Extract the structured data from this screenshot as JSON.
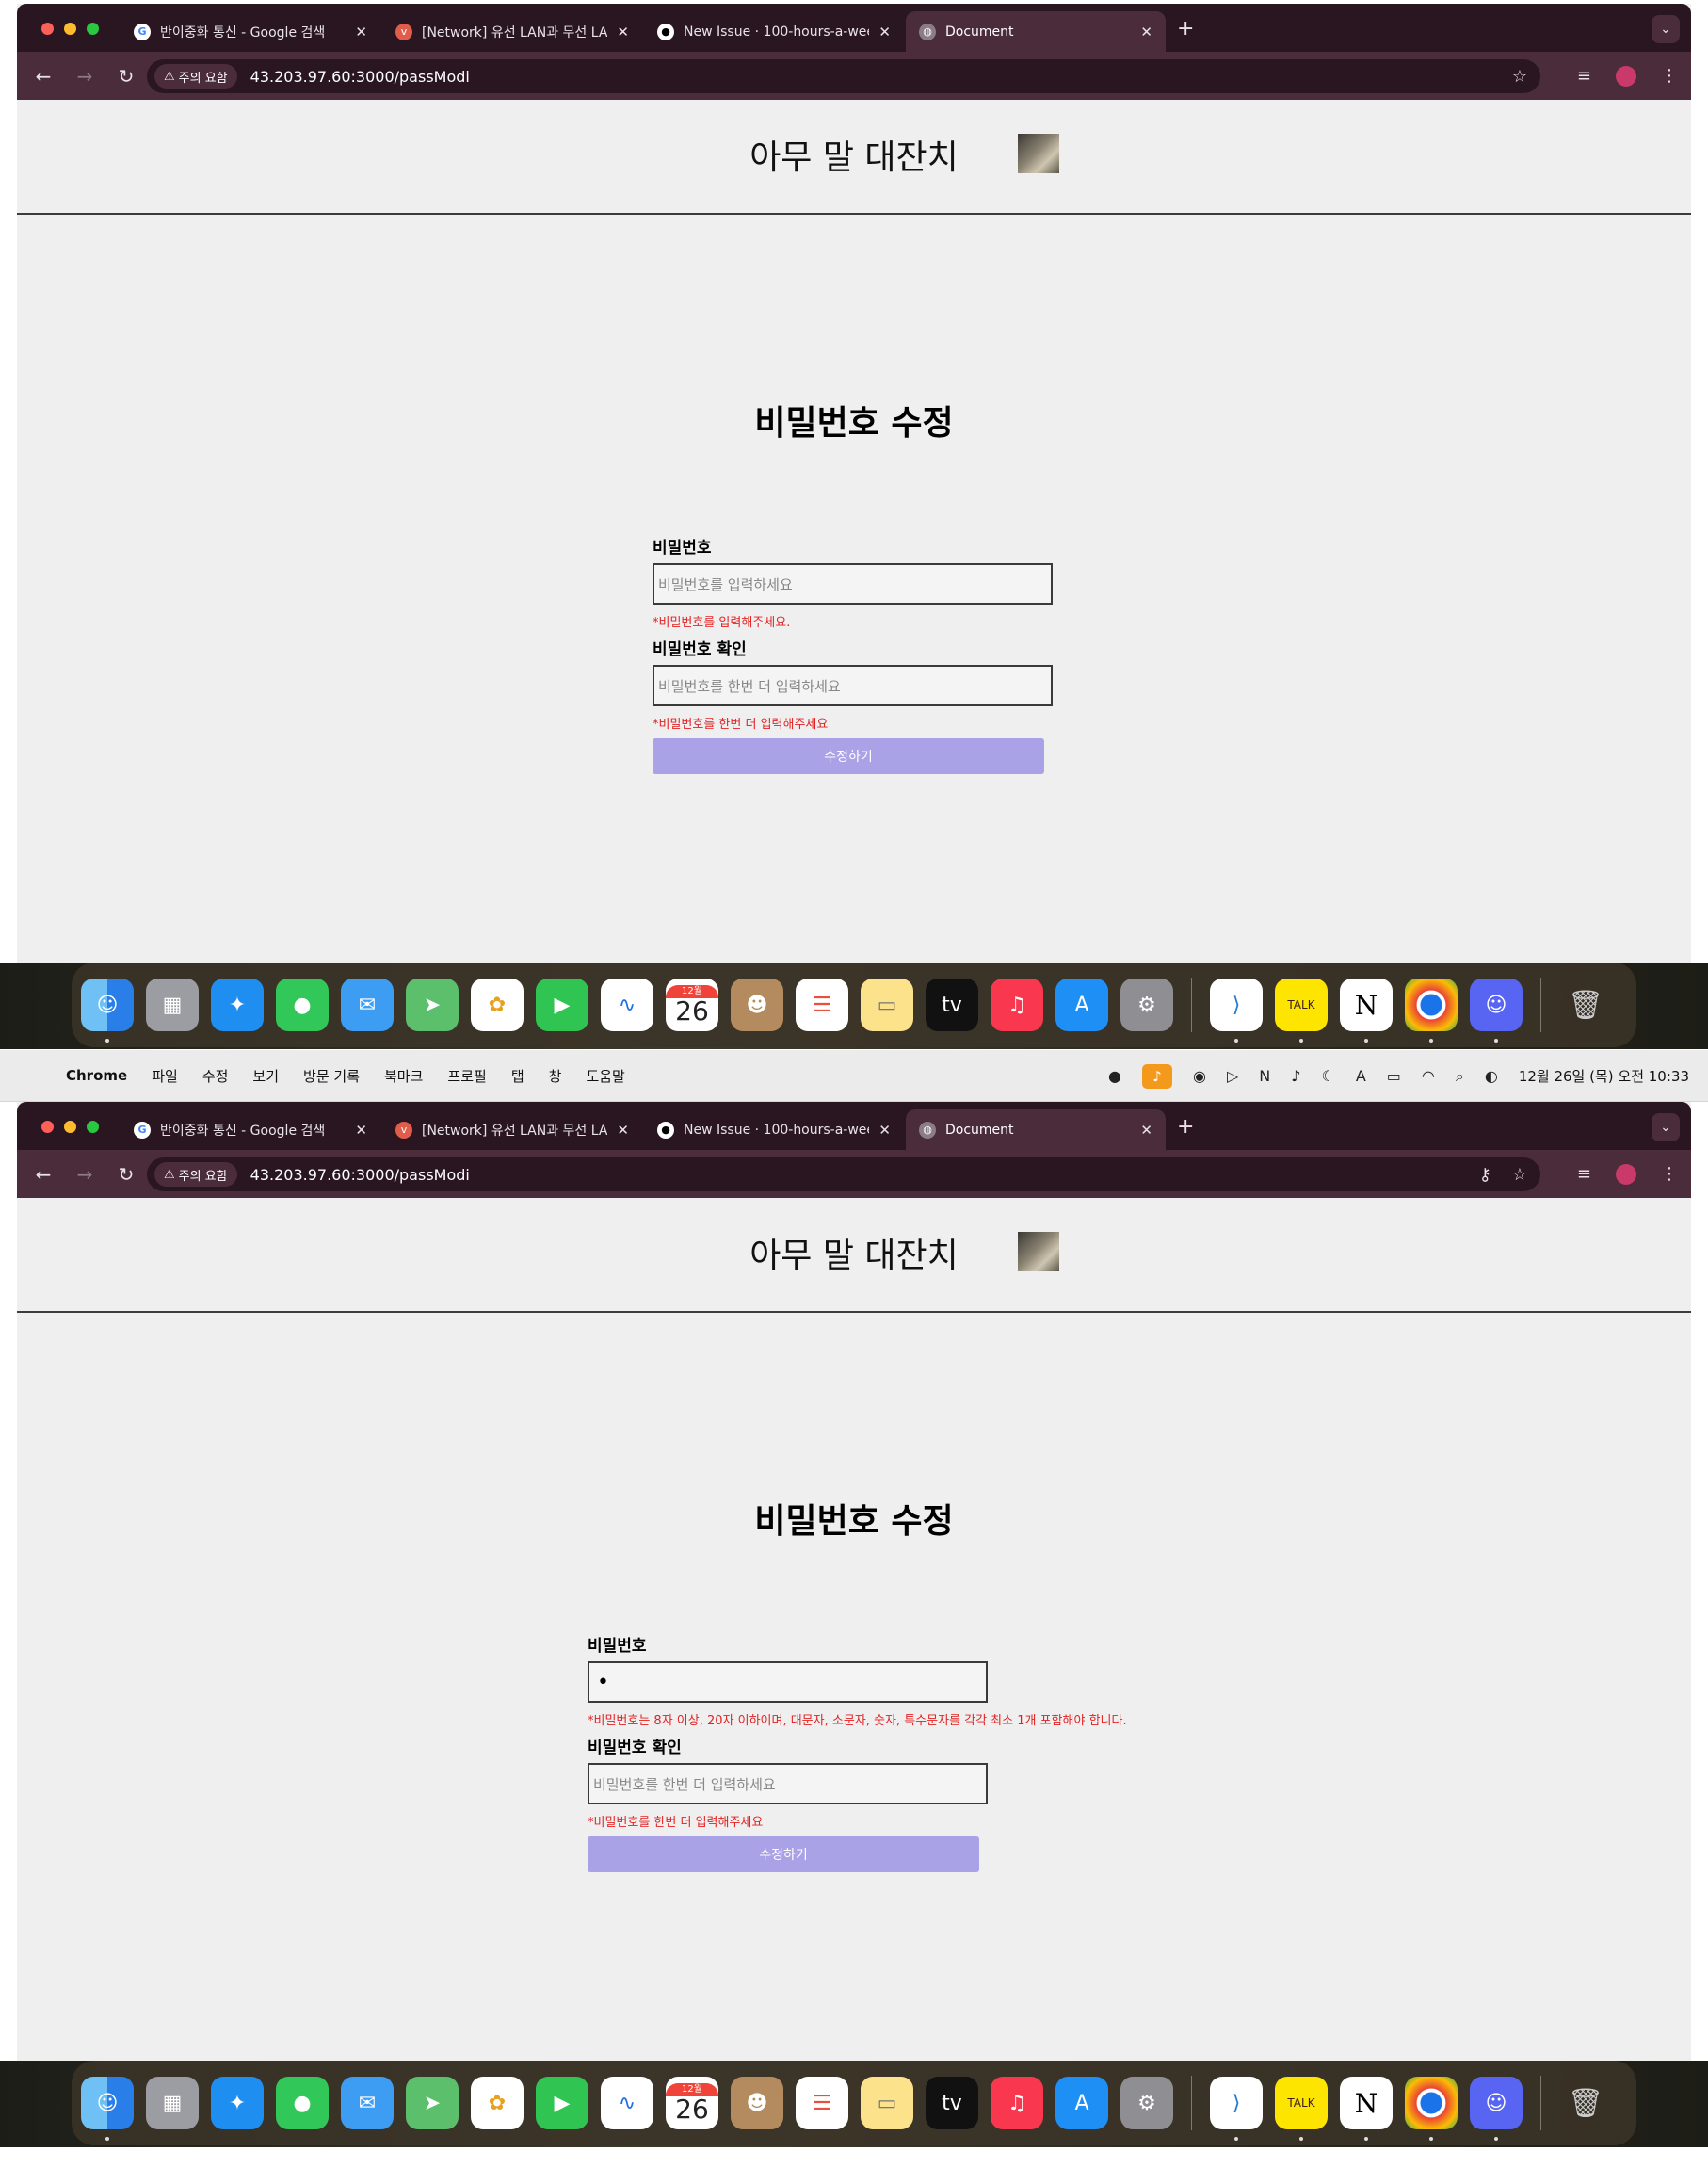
{
  "menubar": {
    "app_name": "Chrome",
    "items": [
      "파일",
      "수정",
      "보기",
      "방문 기록",
      "북마크",
      "프로필",
      "탭",
      "창",
      "도움말"
    ],
    "datetime": "12월 26일 (목) 오전 10:33"
  },
  "browser": {
    "tabs": [
      {
        "title": "반이중화 통신 - Google 검색",
        "icon": "google-icon"
      },
      {
        "title": "[Network] 유선 LAN과 무선 LAN",
        "icon": "velog-icon"
      },
      {
        "title": "New Issue · 100-hours-a-week",
        "icon": "github-icon"
      },
      {
        "title": "Document",
        "icon": "globe-icon",
        "active": true
      }
    ],
    "security_label": "주의 요함",
    "url": "43.203.97.60:3000/passModi"
  },
  "page": {
    "site_title": "아무 말 대잔치",
    "form_title": "비밀번호 수정",
    "password_label": "비밀번호",
    "password_placeholder": "비밀번호를 입력하세요",
    "confirm_label": "비밀번호 확인",
    "confirm_placeholder": "비밀번호를 한번 더 입력하세요",
    "submit_label": "수정하기",
    "state1": {
      "password_error": "*비밀번호를 입력해주세요.",
      "confirm_error": "*비밀번호를 한번 더 입력해주세요"
    },
    "state2": {
      "password_value": "•",
      "password_error": "*비밀번호는 8자 이상, 20자 이하이며, 대문자, 소문자, 숫자, 특수문자를 각각 최소 1개 포함해야 합니다.",
      "confirm_error": "*비밀번호를 한번 더 입력해주세요"
    }
  },
  "dock": {
    "calendar_month": "12월",
    "calendar_day": "26",
    "apps": [
      "finder",
      "launchpad",
      "safari",
      "messages",
      "mail",
      "maps",
      "photos",
      "facetime",
      "freeform",
      "calendar",
      "contacts",
      "reminders",
      "notes",
      "tv",
      "music",
      "app-store",
      "system-settings",
      "vscode",
      "kakaotalk",
      "notion",
      "chrome",
      "discord",
      "trash"
    ]
  },
  "colors": {
    "tab_strip": "#2a1621",
    "toolbar": "#4a2c3a",
    "page_bg": "#efeff0",
    "error": "#e32222",
    "button": "#aaa2e6"
  }
}
